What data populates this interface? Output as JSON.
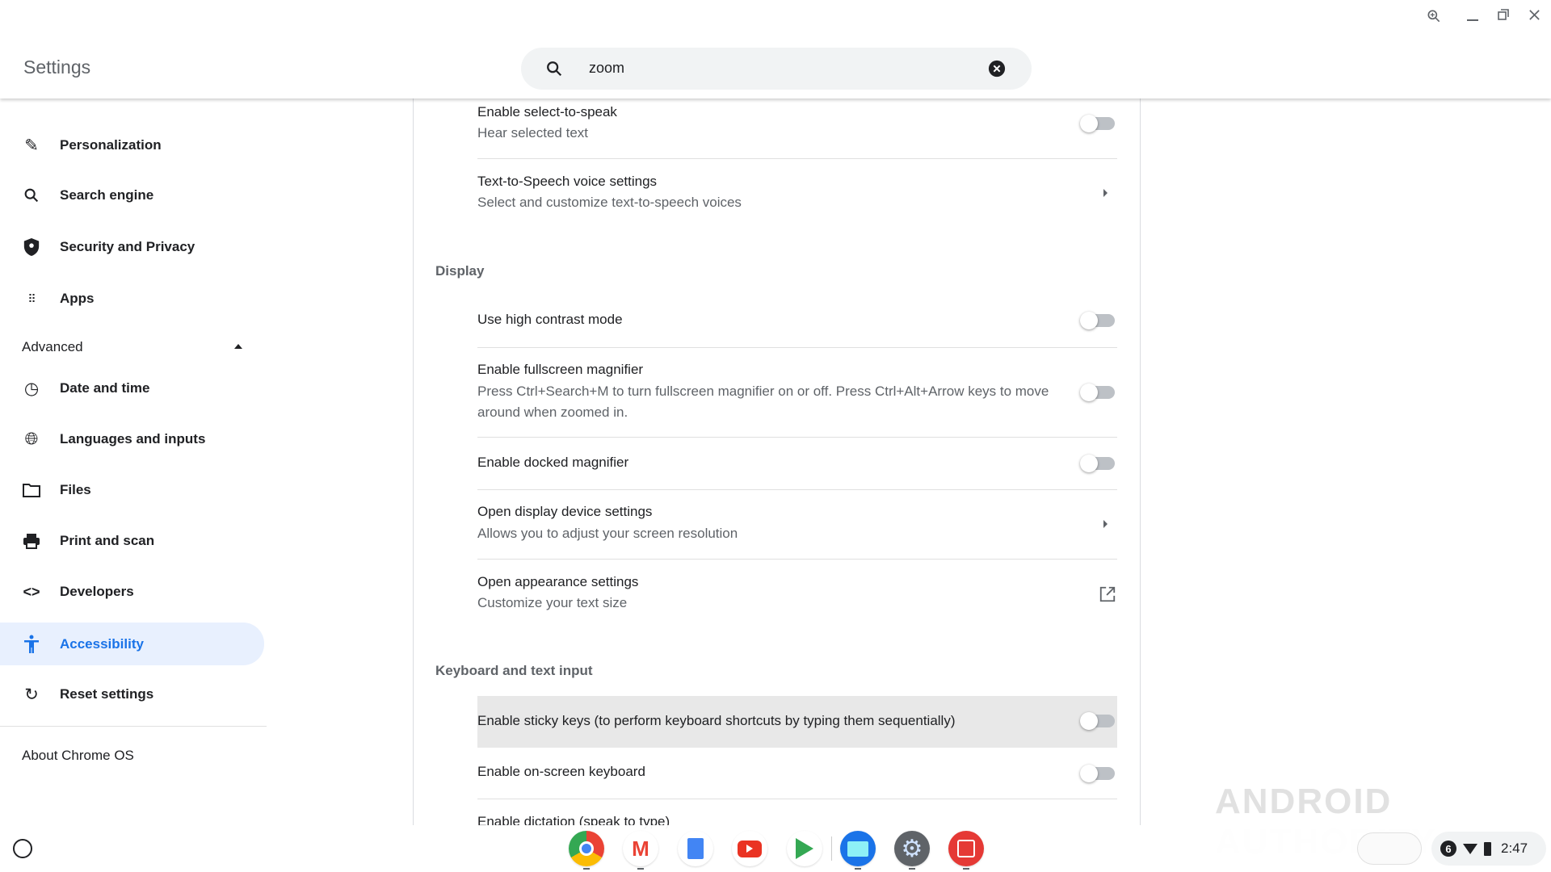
{
  "header": {
    "title": "Settings",
    "search_value": "zoom"
  },
  "sidebar": {
    "items": [
      {
        "label": "Personalization",
        "icon": "pencil-icon"
      },
      {
        "label": "Search engine",
        "icon": "search-icon"
      },
      {
        "label": "Security and Privacy",
        "icon": "shield-icon"
      },
      {
        "label": "Apps",
        "icon": "apps-grid-icon"
      },
      {
        "label": "Date and time",
        "icon": "clock-icon"
      },
      {
        "label": "Languages and inputs",
        "icon": "globe-icon"
      },
      {
        "label": "Files",
        "icon": "folder-icon"
      },
      {
        "label": "Print and scan",
        "icon": "printer-icon"
      },
      {
        "label": "Developers",
        "icon": "code-icon"
      },
      {
        "label": "Accessibility",
        "icon": "accessibility-icon"
      },
      {
        "label": "Reset settings",
        "icon": "reset-icon"
      }
    ],
    "advanced": "Advanced",
    "about": "About Chrome OS",
    "active": "Accessibility"
  },
  "main": {
    "rows": [
      {
        "title": "Enable select-to-speak",
        "sub": "Hear selected text",
        "control": "toggle",
        "on": false
      },
      {
        "title": "Text-to-Speech voice settings",
        "sub": "Select and customize text-to-speech voices",
        "control": "arrow"
      }
    ],
    "display_header": "Display",
    "display_rows": [
      {
        "title": "Use high contrast mode",
        "control": "toggle",
        "on": false
      },
      {
        "title": "Enable fullscreen magnifier",
        "sub1": "Press Ctrl+Search+M to turn fullscreen magnifier on or off. Press Ctrl+Alt+Arrow keys to move",
        "sub2": "around when zoomed in.",
        "control": "toggle",
        "on": false
      },
      {
        "title": "Enable docked magnifier",
        "control": "toggle",
        "on": false
      },
      {
        "title": "Open display device settings",
        "sub": "Allows you to adjust your screen resolution",
        "control": "arrow"
      },
      {
        "title": "Open appearance settings",
        "sub": "Customize your text size",
        "control": "external-link"
      }
    ],
    "keyboard_header": "Keyboard and text input",
    "keyboard_rows": [
      {
        "title": "Enable sticky keys (to perform keyboard shortcuts by typing them sequentially)",
        "control": "toggle",
        "on": false
      },
      {
        "title": "Enable on-screen keyboard",
        "control": "toggle",
        "on": false
      },
      {
        "title": "Enable dictation (speak to type)"
      }
    ]
  },
  "shelf": {
    "apps": [
      "Chrome",
      "Gmail",
      "Docs",
      "YouTube",
      "Play Store",
      "Files",
      "Settings",
      "Screencast"
    ],
    "notifications": "6",
    "time": "2:47"
  },
  "watermark": "ANDROID AUTHORITY",
  "colors": {
    "accent": "#1a73e8",
    "active_bg": "#e8f0fe"
  }
}
